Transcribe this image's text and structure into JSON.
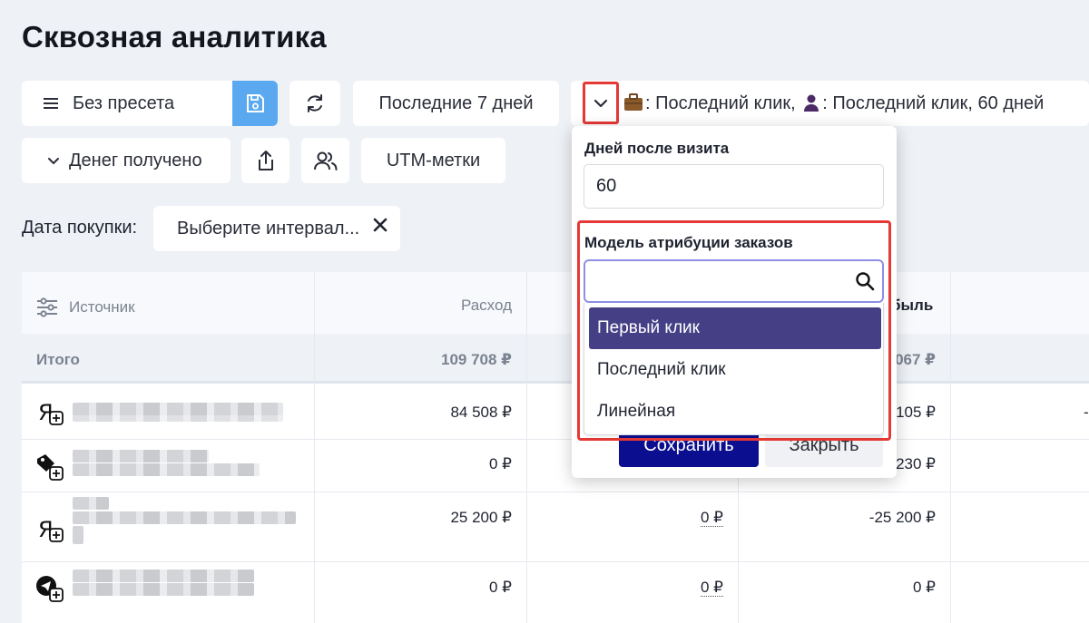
{
  "page": {
    "title": "Сквозная аналитика"
  },
  "toolbar": {
    "preset_label": "Без пресета",
    "period_label": "Последние 7 дней",
    "attribution_label": ": Последний клик,",
    "attribution_label2": ": Последний клик, 60 дней",
    "money_label": "Денег получено",
    "utm_label": "UTM-метки"
  },
  "filter": {
    "date_label": "Дата покупки:",
    "date_placeholder": "Выберите интервал..."
  },
  "table": {
    "headers": {
      "source": "Источник",
      "expense": "Расход",
      "profit_partial": "быль"
    },
    "total": {
      "label": "Итого",
      "expense": "109 708 ₽",
      "profit_partial": "067 ₽"
    },
    "rows": [
      {
        "icon": "yandex-icon",
        "expense": "84 508 ₽",
        "revenue": "",
        "profit": "105 ₽",
        "extra": "-"
      },
      {
        "icon": "tag-icon",
        "expense": "0 ₽",
        "revenue": "",
        "profit": "230 ₽",
        "extra": ""
      },
      {
        "icon": "yandex-icon",
        "expense": "25 200 ₽",
        "revenue": "0 ₽",
        "profit": "-25 200 ₽",
        "extra": ""
      },
      {
        "icon": "telegram-icon",
        "expense": "0 ₽",
        "revenue": "0 ₽",
        "profit": "0 ₽",
        "extra": ""
      }
    ]
  },
  "popup": {
    "days_label": "Дней после визита",
    "days_value": "60",
    "model_label": "Модель атрибуции заказов",
    "search_value": "",
    "options": [
      "Первый клик",
      "Последний клик",
      "Линейная"
    ],
    "selected_index": 0,
    "save_label": "Сохранить",
    "close_label": "Закрыть"
  },
  "colors": {
    "accent": "#453f86",
    "save_blue": "#5aa9f0",
    "highlight_red": "#e53935",
    "primary_button": "#0b0f8f"
  }
}
